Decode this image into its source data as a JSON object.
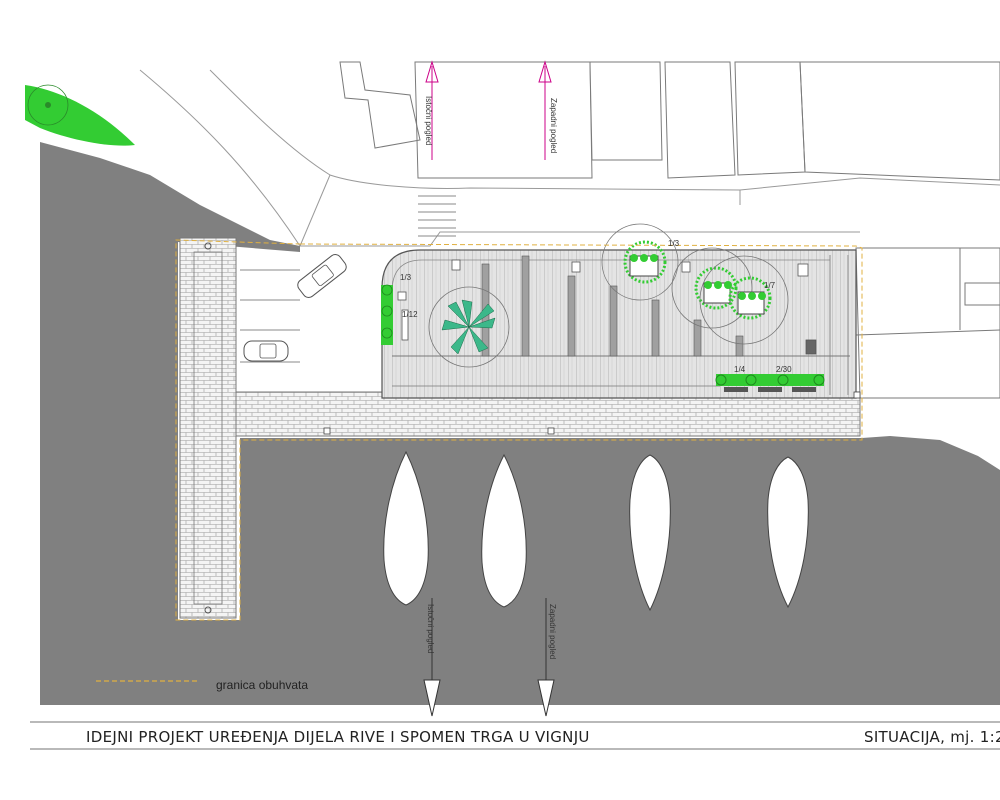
{
  "title_block": {
    "project_title": "IDEJNI PROJEKT UREĐENJA DIJELA RIVE I SPOMEN TRGA U VIGNJU",
    "sheet_title": "SITUACIJA, mj. 1:2"
  },
  "legend": {
    "boundary_label": "granica obuhvata"
  },
  "view_markers": {
    "top_left": "Istočni pogled",
    "top_right": "Zapadni pogled",
    "bottom_left": "Istočni pogled",
    "bottom_right": "Zapadni pogled"
  },
  "element_tags": {
    "tag_bench_left": "1/3",
    "tag_bench_planter": "1/12",
    "tag_tree_top": "1/3",
    "tag_tree_right": "1/7",
    "tag_planter_left": "1/4",
    "tag_planter_right": "2/30"
  },
  "colors": {
    "sea": "#808080",
    "greenery": "#33cc33",
    "boundary": "#e0b040",
    "arrow": "#cc0088"
  }
}
